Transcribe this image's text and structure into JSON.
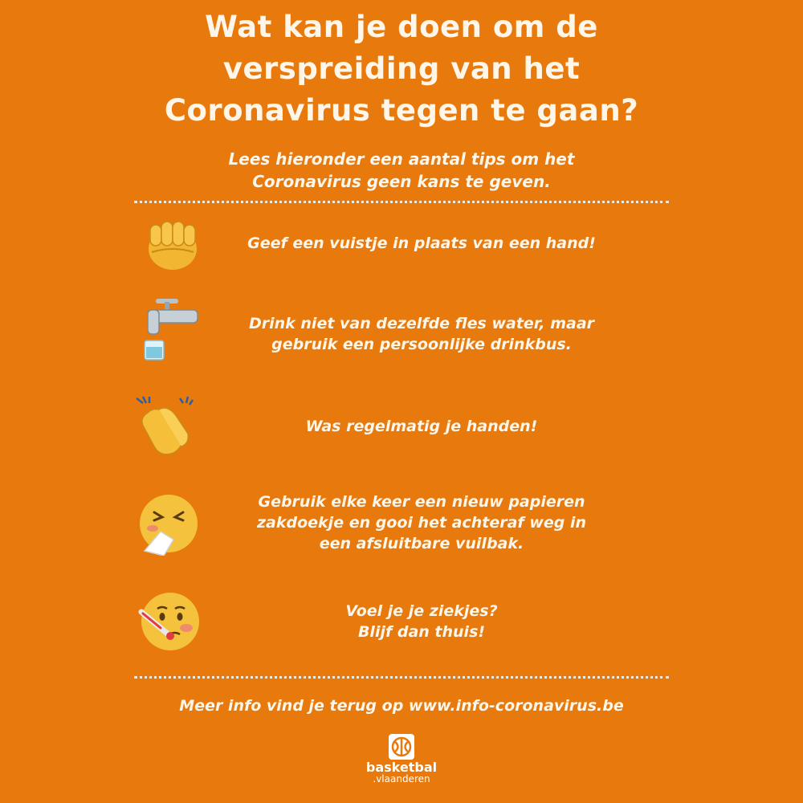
{
  "title": {
    "lines": [
      "Wat kan je doen om de",
      "verspreiding van het",
      "Coronavirus tegen te gaan?"
    ]
  },
  "subtitle": {
    "lines": [
      "Lees hieronder een aantal tips om het",
      "Coronavirus geen kans te geven."
    ]
  },
  "tips": [
    {
      "icon": "fist-bump-icon",
      "lines": [
        "Geef een vuistje in plaats van een hand!"
      ]
    },
    {
      "icon": "water-tap-glass-icon",
      "lines": [
        "Drink niet van dezelfde fles water, maar",
        "gebruik een persoonlijke drinkbus."
      ]
    },
    {
      "icon": "clapping-hands-icon",
      "lines": [
        "Was regelmatig je handen!"
      ]
    },
    {
      "icon": "sneezing-face-icon",
      "lines": [
        "Gebruik elke keer een nieuw papieren",
        "zakdoekje en gooi het achteraf weg in",
        "een afsluitbare vuilbak."
      ]
    },
    {
      "icon": "face-with-thermometer-icon",
      "lines": [
        "Voel je je ziekjes?",
        "Blijf dan thuis!"
      ]
    }
  ],
  "footer": {
    "info": "Meer info vind je terug op www.info-coronavirus.be"
  },
  "logo": {
    "brand_line1": "basketbal",
    "brand_line2": ".vlaanderen"
  },
  "colors": {
    "background": "#e8790c",
    "text": "#fff6ea"
  }
}
